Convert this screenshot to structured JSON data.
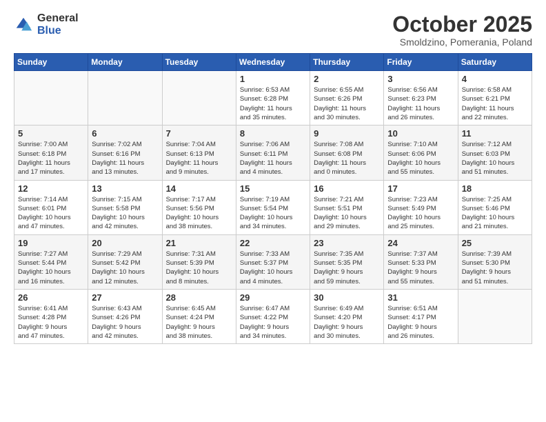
{
  "logo": {
    "general": "General",
    "blue": "Blue"
  },
  "header": {
    "month": "October 2025",
    "location": "Smoldzino, Pomerania, Poland"
  },
  "days_of_week": [
    "Sunday",
    "Monday",
    "Tuesday",
    "Wednesday",
    "Thursday",
    "Friday",
    "Saturday"
  ],
  "weeks": [
    [
      {
        "day": "",
        "info": ""
      },
      {
        "day": "",
        "info": ""
      },
      {
        "day": "",
        "info": ""
      },
      {
        "day": "1",
        "info": "Sunrise: 6:53 AM\nSunset: 6:28 PM\nDaylight: 11 hours\nand 35 minutes."
      },
      {
        "day": "2",
        "info": "Sunrise: 6:55 AM\nSunset: 6:26 PM\nDaylight: 11 hours\nand 30 minutes."
      },
      {
        "day": "3",
        "info": "Sunrise: 6:56 AM\nSunset: 6:23 PM\nDaylight: 11 hours\nand 26 minutes."
      },
      {
        "day": "4",
        "info": "Sunrise: 6:58 AM\nSunset: 6:21 PM\nDaylight: 11 hours\nand 22 minutes."
      }
    ],
    [
      {
        "day": "5",
        "info": "Sunrise: 7:00 AM\nSunset: 6:18 PM\nDaylight: 11 hours\nand 17 minutes."
      },
      {
        "day": "6",
        "info": "Sunrise: 7:02 AM\nSunset: 6:16 PM\nDaylight: 11 hours\nand 13 minutes."
      },
      {
        "day": "7",
        "info": "Sunrise: 7:04 AM\nSunset: 6:13 PM\nDaylight: 11 hours\nand 9 minutes."
      },
      {
        "day": "8",
        "info": "Sunrise: 7:06 AM\nSunset: 6:11 PM\nDaylight: 11 hours\nand 4 minutes."
      },
      {
        "day": "9",
        "info": "Sunrise: 7:08 AM\nSunset: 6:08 PM\nDaylight: 11 hours\nand 0 minutes."
      },
      {
        "day": "10",
        "info": "Sunrise: 7:10 AM\nSunset: 6:06 PM\nDaylight: 10 hours\nand 55 minutes."
      },
      {
        "day": "11",
        "info": "Sunrise: 7:12 AM\nSunset: 6:03 PM\nDaylight: 10 hours\nand 51 minutes."
      }
    ],
    [
      {
        "day": "12",
        "info": "Sunrise: 7:14 AM\nSunset: 6:01 PM\nDaylight: 10 hours\nand 47 minutes."
      },
      {
        "day": "13",
        "info": "Sunrise: 7:15 AM\nSunset: 5:58 PM\nDaylight: 10 hours\nand 42 minutes."
      },
      {
        "day": "14",
        "info": "Sunrise: 7:17 AM\nSunset: 5:56 PM\nDaylight: 10 hours\nand 38 minutes."
      },
      {
        "day": "15",
        "info": "Sunrise: 7:19 AM\nSunset: 5:54 PM\nDaylight: 10 hours\nand 34 minutes."
      },
      {
        "day": "16",
        "info": "Sunrise: 7:21 AM\nSunset: 5:51 PM\nDaylight: 10 hours\nand 29 minutes."
      },
      {
        "day": "17",
        "info": "Sunrise: 7:23 AM\nSunset: 5:49 PM\nDaylight: 10 hours\nand 25 minutes."
      },
      {
        "day": "18",
        "info": "Sunrise: 7:25 AM\nSunset: 5:46 PM\nDaylight: 10 hours\nand 21 minutes."
      }
    ],
    [
      {
        "day": "19",
        "info": "Sunrise: 7:27 AM\nSunset: 5:44 PM\nDaylight: 10 hours\nand 16 minutes."
      },
      {
        "day": "20",
        "info": "Sunrise: 7:29 AM\nSunset: 5:42 PM\nDaylight: 10 hours\nand 12 minutes."
      },
      {
        "day": "21",
        "info": "Sunrise: 7:31 AM\nSunset: 5:39 PM\nDaylight: 10 hours\nand 8 minutes."
      },
      {
        "day": "22",
        "info": "Sunrise: 7:33 AM\nSunset: 5:37 PM\nDaylight: 10 hours\nand 4 minutes."
      },
      {
        "day": "23",
        "info": "Sunrise: 7:35 AM\nSunset: 5:35 PM\nDaylight: 9 hours\nand 59 minutes."
      },
      {
        "day": "24",
        "info": "Sunrise: 7:37 AM\nSunset: 5:33 PM\nDaylight: 9 hours\nand 55 minutes."
      },
      {
        "day": "25",
        "info": "Sunrise: 7:39 AM\nSunset: 5:30 PM\nDaylight: 9 hours\nand 51 minutes."
      }
    ],
    [
      {
        "day": "26",
        "info": "Sunrise: 6:41 AM\nSunset: 4:28 PM\nDaylight: 9 hours\nand 47 minutes."
      },
      {
        "day": "27",
        "info": "Sunrise: 6:43 AM\nSunset: 4:26 PM\nDaylight: 9 hours\nand 42 minutes."
      },
      {
        "day": "28",
        "info": "Sunrise: 6:45 AM\nSunset: 4:24 PM\nDaylight: 9 hours\nand 38 minutes."
      },
      {
        "day": "29",
        "info": "Sunrise: 6:47 AM\nSunset: 4:22 PM\nDaylight: 9 hours\nand 34 minutes."
      },
      {
        "day": "30",
        "info": "Sunrise: 6:49 AM\nSunset: 4:20 PM\nDaylight: 9 hours\nand 30 minutes."
      },
      {
        "day": "31",
        "info": "Sunrise: 6:51 AM\nSunset: 4:17 PM\nDaylight: 9 hours\nand 26 minutes."
      },
      {
        "day": "",
        "info": ""
      }
    ]
  ]
}
